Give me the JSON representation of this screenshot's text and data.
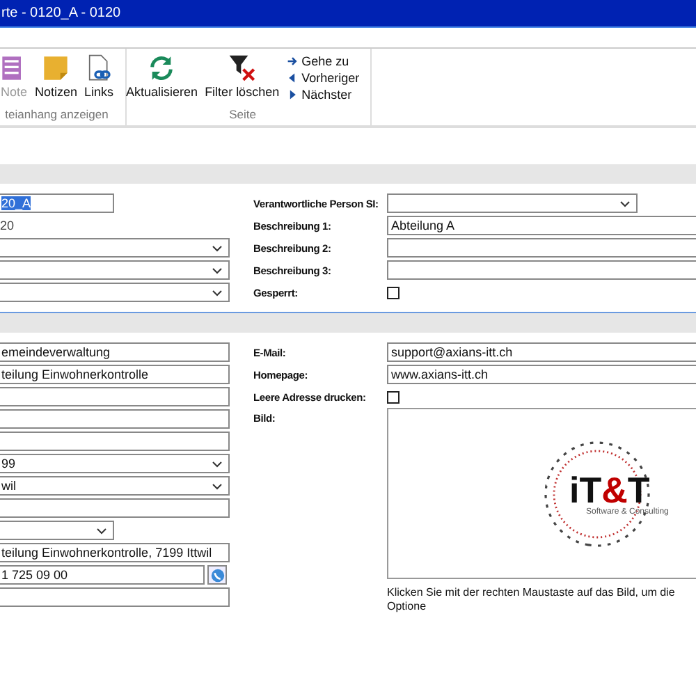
{
  "window": {
    "title": "rte - 0120_A - 0120"
  },
  "ribbon": {
    "groups": [
      {
        "label": "teianhang anzeigen",
        "items": [
          {
            "kind": "note",
            "label": "Note",
            "disabled": true
          },
          {
            "kind": "notes",
            "label": "Notizen",
            "disabled": false
          },
          {
            "kind": "links",
            "label": "Links",
            "disabled": false
          }
        ]
      },
      {
        "label": "Seite",
        "items": [
          {
            "kind": "refresh",
            "label": "Aktualisieren",
            "disabled": false
          },
          {
            "kind": "filter",
            "label": "Filter löschen",
            "disabled": false
          }
        ],
        "nav": [
          {
            "kind": "goto",
            "label": "Gehe zu"
          },
          {
            "kind": "prev",
            "label": "Vorheriger"
          },
          {
            "kind": "next",
            "label": "Nächster"
          }
        ]
      }
    ]
  },
  "section1": {
    "left": [
      {
        "kind": "text",
        "value": "20_A",
        "short": true,
        "text_selected": true
      },
      {
        "kind": "plain",
        "value": "20"
      },
      {
        "kind": "dropdown"
      },
      {
        "kind": "dropdown"
      },
      {
        "kind": "dropdown"
      }
    ],
    "right": [
      {
        "label": "Verantwortliche Person SI:",
        "kind": "dropdown"
      },
      {
        "label": "Beschreibung 1:",
        "kind": "text",
        "value": "Abteilung A"
      },
      {
        "label": "Beschreibung 2:",
        "kind": "text"
      },
      {
        "label": "Beschreibung 3:",
        "kind": "text"
      },
      {
        "label": "Gesperrt:",
        "kind": "checkbox",
        "checked": false
      }
    ]
  },
  "section2": {
    "left": [
      {
        "kind": "text",
        "value": "emeindeverwaltung"
      },
      {
        "kind": "text",
        "value": "teilung Einwohnerkontrolle"
      },
      {
        "kind": "text"
      },
      {
        "kind": "text"
      },
      {
        "kind": "text"
      },
      {
        "kind": "dropdown",
        "value": "99"
      },
      {
        "kind": "dropdown",
        "value": "wil"
      },
      {
        "kind": "text"
      },
      {
        "kind": "dropdown",
        "short": true
      },
      {
        "kind": "text",
        "value": "teilung Einwohnerkontrolle, 7199 Ittwil"
      },
      {
        "kind": "phone",
        "value": "1 725 09 00"
      },
      {
        "kind": "text"
      }
    ],
    "right": [
      {
        "label": "E-Mail:",
        "kind": "text",
        "value": "support@axians-itt.ch"
      },
      {
        "label": "Homepage:",
        "kind": "text",
        "value": "www.axians-itt.ch"
      },
      {
        "label": "Leere Adresse drucken:",
        "kind": "checkbox",
        "checked": false
      },
      {
        "label": "Bild:",
        "kind": "image",
        "logo": {
          "parts": [
            {
              "text": "iT",
              "color": "#111111"
            },
            {
              "text": "&",
              "color": "#c00000"
            },
            {
              "text": "T",
              "color": "#111111"
            }
          ],
          "tagline": "Software & Consulting"
        }
      }
    ],
    "caption": "Klicken Sie mit der rechten Maustaste auf das Bild, um die Optione"
  }
}
